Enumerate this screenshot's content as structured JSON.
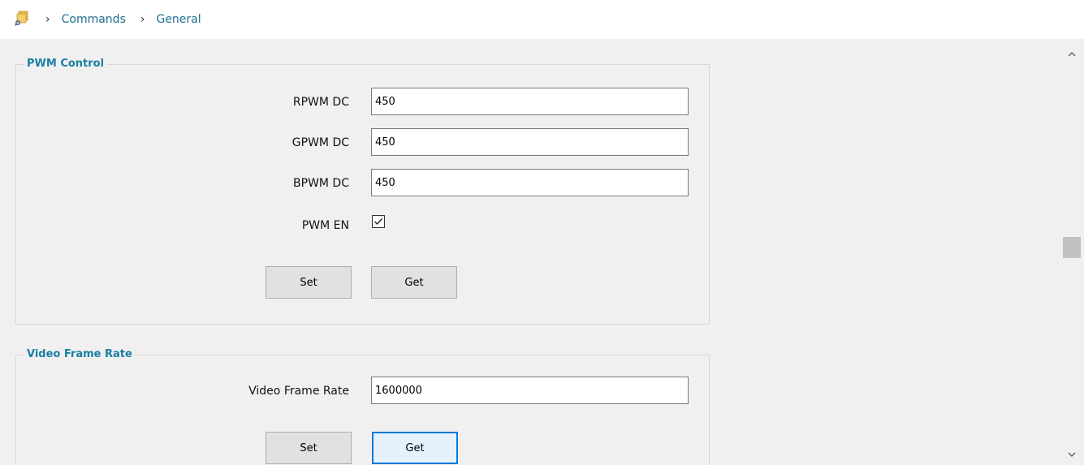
{
  "breadcrumb": {
    "icon": "folder-search-icon",
    "items": [
      "Commands",
      "General"
    ],
    "separator": "›"
  },
  "pwm_control": {
    "legend": "PWM Control",
    "rpwm": {
      "label": "RPWM DC",
      "value": "450"
    },
    "gpwm": {
      "label": "GPWM DC",
      "value": "450"
    },
    "bpwm": {
      "label": "BPWM DC",
      "value": "450"
    },
    "pwm_en": {
      "label": "PWM EN",
      "checked": true
    },
    "set_label": "Set",
    "get_label": "Get"
  },
  "video_frame_rate": {
    "legend": "Video Frame Rate",
    "field": {
      "label": "Video Frame Rate",
      "value": "1600000"
    },
    "set_label": "Set",
    "get_label": "Get"
  },
  "colors": {
    "legend": "#1a7fa3",
    "link": "#1a6e8e",
    "focus": "#0078d7"
  }
}
